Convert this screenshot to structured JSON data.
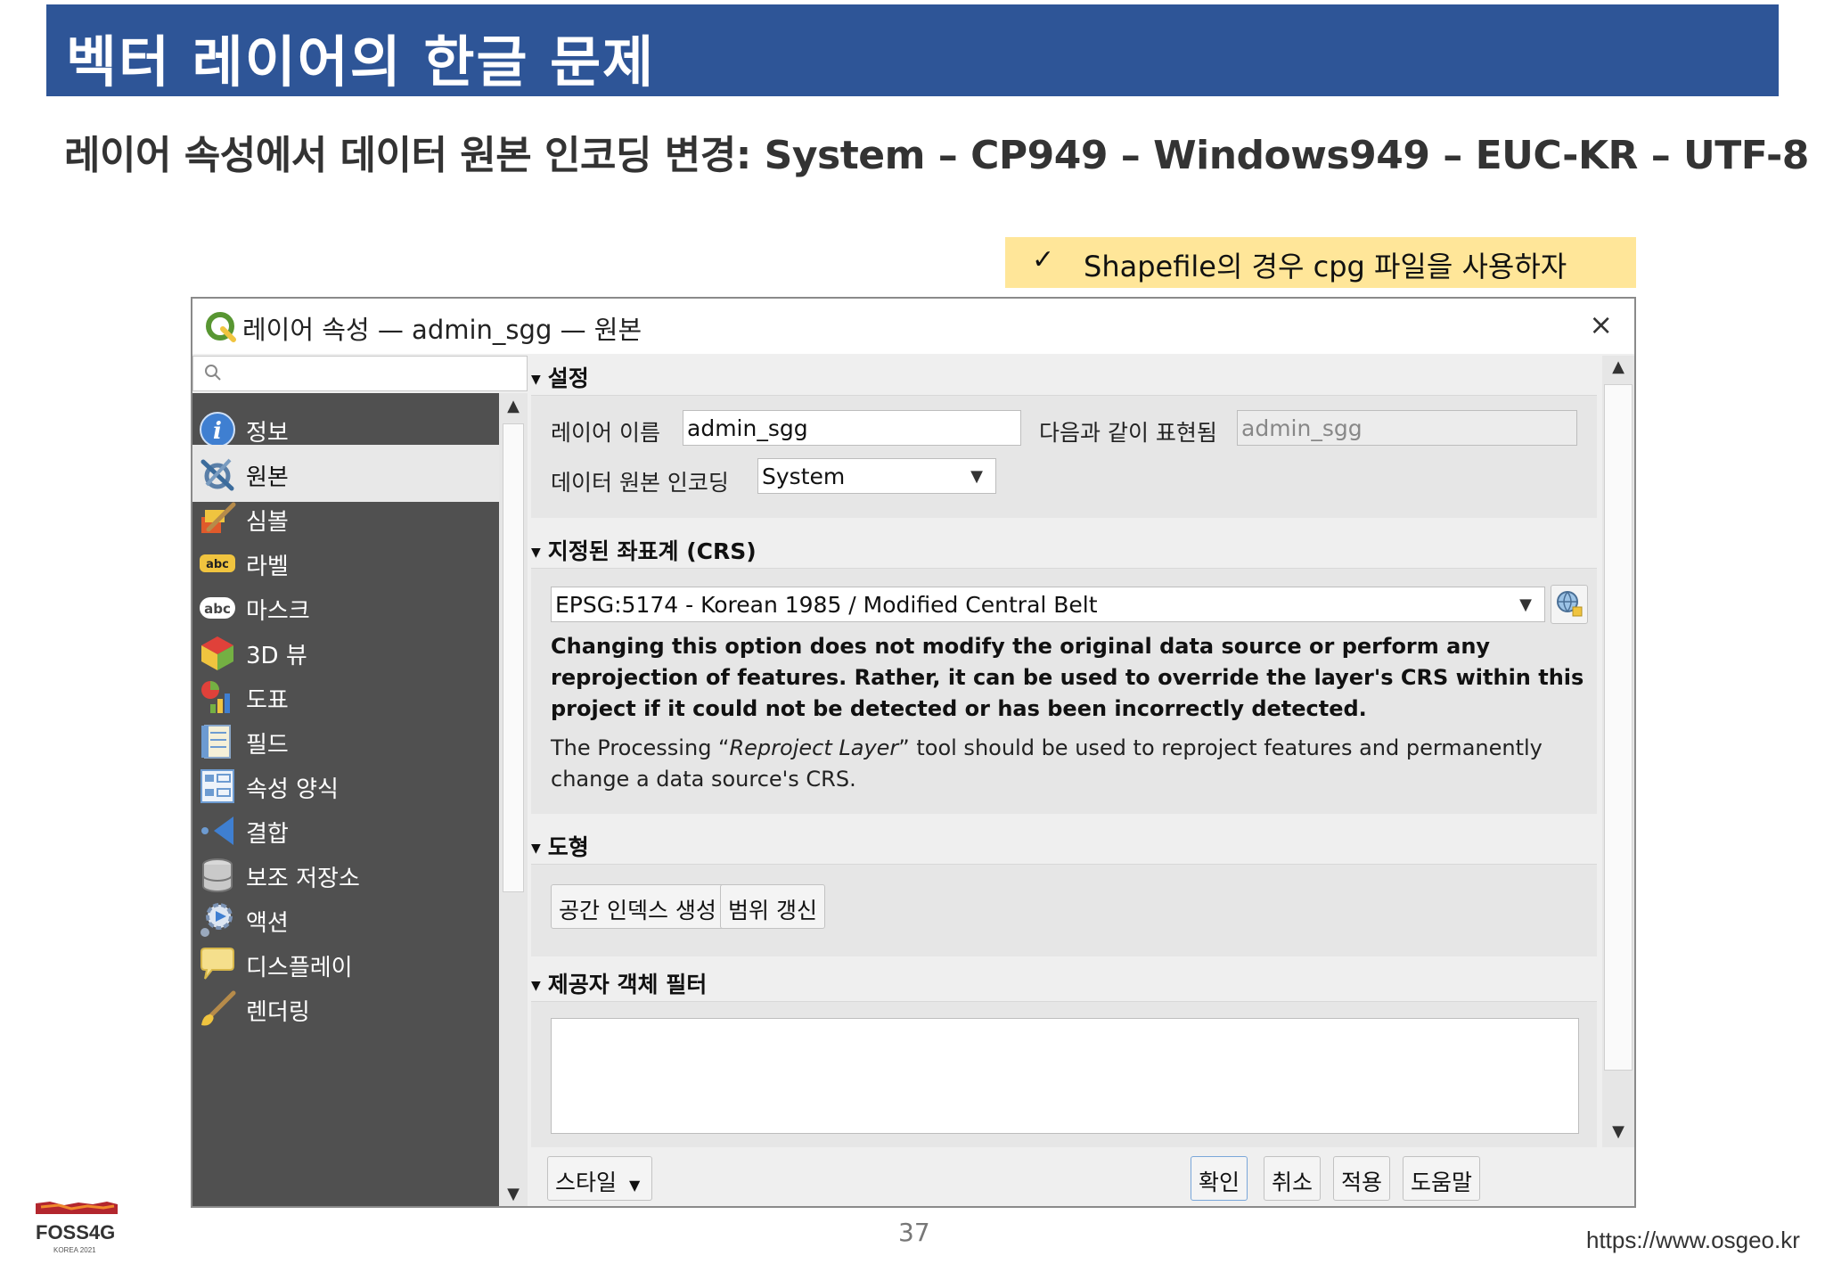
{
  "slide": {
    "title": "벡터 레이어의 한글 문제",
    "subtitle": "레이어 속성에서 데이터 원본 인코딩 변경: System – CP949 – Windows949 – EUC-KR – UTF-8",
    "note_check": "✓",
    "note": "Shapefile의 경우 cpg 파일을 사용하자",
    "page_number": "37",
    "url": "https://www.osgeo.kr",
    "logo_name": "FOSS4G",
    "logo_sub": "KOREA 2021"
  },
  "dialog": {
    "title": "레이어 속성 — admin_sgg — 원본",
    "close": "×",
    "search": {
      "placeholder": "",
      "value": ""
    },
    "sidebar": {
      "items": [
        {
          "label": "정보",
          "icon": "info-icon"
        },
        {
          "label": "원본",
          "icon": "source-tools-icon",
          "selected": true
        },
        {
          "label": "심볼",
          "icon": "symbology-brush-icon"
        },
        {
          "label": "라벨",
          "icon": "labels-abc-icon"
        },
        {
          "label": "마스크",
          "icon": "mask-abc-icon"
        },
        {
          "label": "3D 뷰",
          "icon": "cube-3d-icon"
        },
        {
          "label": "도표",
          "icon": "diagram-icon"
        },
        {
          "label": "필드",
          "icon": "fields-icon"
        },
        {
          "label": "속성 양식",
          "icon": "attributes-form-icon"
        },
        {
          "label": "결합",
          "icon": "joins-icon"
        },
        {
          "label": "보조 저장소",
          "icon": "auxiliary-storage-icon"
        },
        {
          "label": "액션",
          "icon": "actions-gear-icon"
        },
        {
          "label": "디스플레이",
          "icon": "display-tooltip-icon"
        },
        {
          "label": "렌더링",
          "icon": "rendering-brush-icon"
        }
      ]
    },
    "settings": {
      "header": "설정",
      "layer_name_label": "레이어 이름",
      "layer_name_value": "admin_sgg",
      "displayed_as_label": "다음과 같이 표현됨",
      "displayed_as_value": "admin_sgg",
      "encoding_label": "데이터 원본 인코딩",
      "encoding_value": "System"
    },
    "crs": {
      "header": "지정된 좌표계 (CRS)",
      "value": "EPSG:5174 - Korean 1985 / Modified Central Belt",
      "warning": "Changing this option does not modify the original data source or perform any reprojection of features. Rather, it can be used to override the layer's CRS within this project if it could not be detected or has been incorrectly detected.",
      "info_prefix": "The Processing “",
      "info_tool": "Reproject Layer",
      "info_suffix": "” tool should be used to reproject features and permanently change a data source's CRS."
    },
    "geometry": {
      "header": "도형",
      "create_index_button": "공간 인덱스 생성",
      "update_extents_button": "범위 갱신"
    },
    "provider_filter": {
      "header": "제공자 객체 필터",
      "value": ""
    },
    "footer": {
      "style_button": "스타일",
      "ok_button": "확인",
      "cancel_button": "취소",
      "apply_button": "적용",
      "help_button": "도움말"
    }
  },
  "colors": {
    "title_bar": "#2e5597",
    "note_bg": "#ffe699",
    "sidebar_bg": "#505050",
    "qgis_green": "#589632",
    "qgis_yellow": "#f0c43f"
  }
}
